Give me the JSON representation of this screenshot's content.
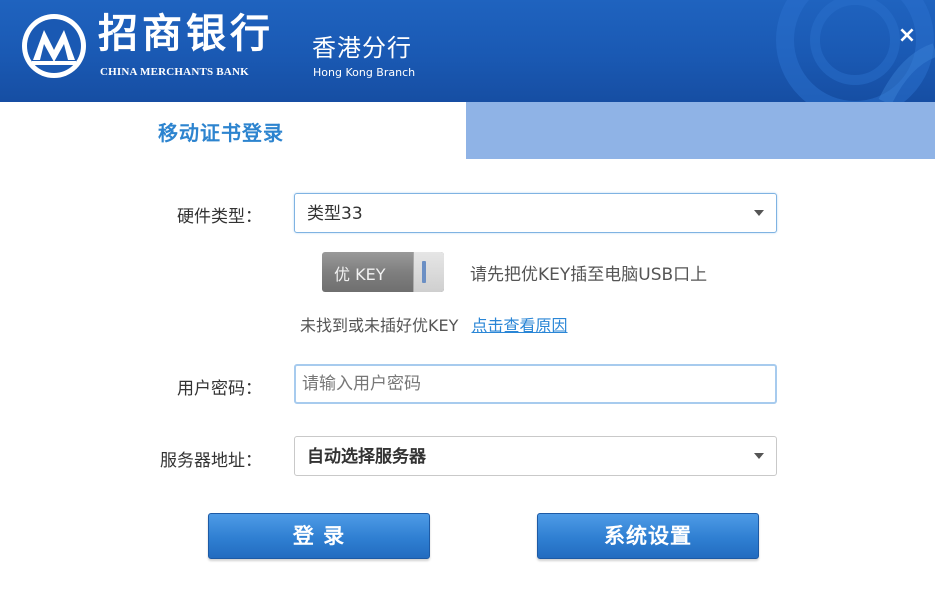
{
  "header": {
    "bank_name_cn": "招商银行",
    "bank_name_en": "CHINA MERCHANTS BANK",
    "branch_cn": "香港分行",
    "branch_en": "Hong Kong Branch",
    "close_label": "×",
    "logo_icon": "cmb-logo-icon",
    "brand_color": "#1a59b3"
  },
  "tab": {
    "title": "移动证书登录",
    "strip_color": "#8fb3e6"
  },
  "form": {
    "hardware_type": {
      "label": "硬件类型：",
      "value": "类型33"
    },
    "usb_key": {
      "key_text": "优 KEY",
      "hint": "请先把优KEY插至电脑USB口上"
    },
    "not_found": {
      "text": "未找到或未插好优KEY",
      "link": "点击查看原因"
    },
    "password": {
      "label": "用户密码：",
      "placeholder": "请输入用户密码"
    },
    "server": {
      "label": "服务器地址：",
      "value": "自动选择服务器"
    }
  },
  "buttons": {
    "login": "登 录",
    "settings": "系统设置"
  }
}
